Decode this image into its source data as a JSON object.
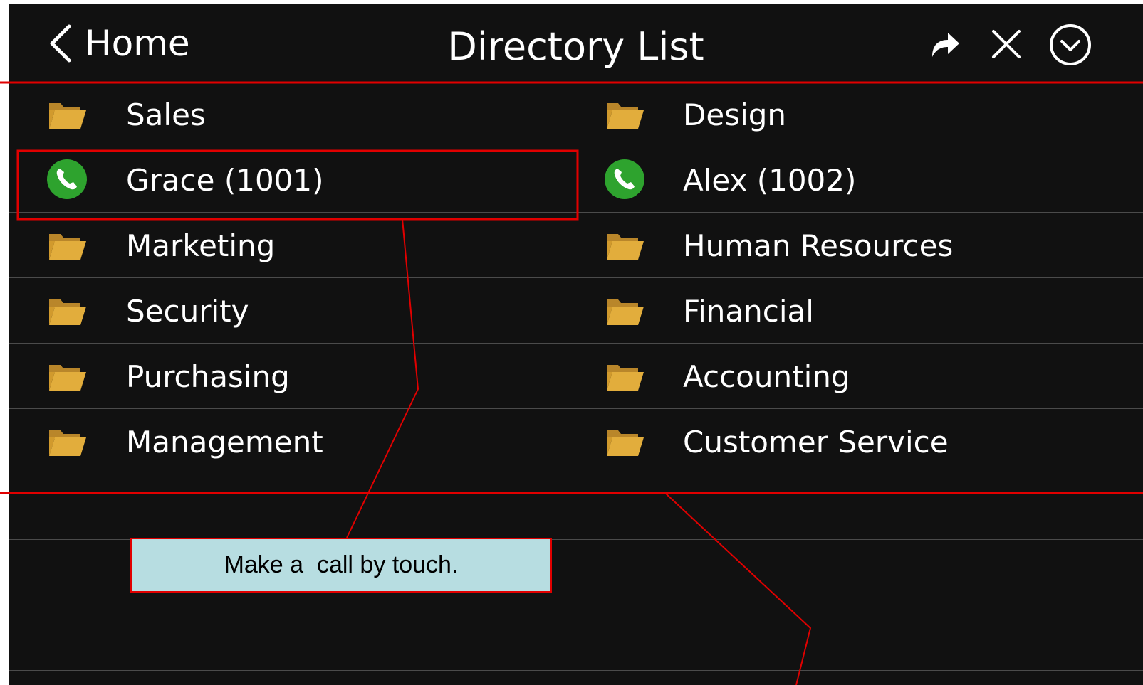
{
  "header": {
    "back_label": "Home",
    "title": "Directory List",
    "icons": [
      "back-chevron-icon",
      "forward-arrow-icon",
      "close-icon",
      "chevron-down-circle-icon"
    ]
  },
  "directory": {
    "rows": [
      {
        "left": {
          "label": "Sales",
          "icon": "folder-icon"
        },
        "right": {
          "label": "Design",
          "icon": "folder-icon"
        }
      },
      {
        "left": {
          "label": "Grace (1001)",
          "icon": "phone-icon"
        },
        "right": {
          "label": "Alex (1002)",
          "icon": "phone-icon"
        }
      },
      {
        "left": {
          "label": "Marketing",
          "icon": "folder-icon"
        },
        "right": {
          "label": "Human Resources",
          "icon": "folder-icon"
        }
      },
      {
        "left": {
          "label": "Security",
          "icon": "folder-icon"
        },
        "right": {
          "label": "Financial",
          "icon": "folder-icon"
        }
      },
      {
        "left": {
          "label": "Purchasing",
          "icon": "folder-icon"
        },
        "right": {
          "label": "Accounting",
          "icon": "folder-icon"
        }
      },
      {
        "left": {
          "label": "Management",
          "icon": "folder-icon"
        },
        "right": {
          "label": "Customer Service",
          "icon": "folder-icon"
        }
      }
    ]
  },
  "annotation": {
    "callout_text": "Make a  call by touch."
  },
  "colors": {
    "screen_bg": "#111111",
    "folder": "#e2ad3c",
    "phone": "#2ea32e",
    "annotation_red": "#e10000",
    "callout_bg": "#b7dde1"
  }
}
